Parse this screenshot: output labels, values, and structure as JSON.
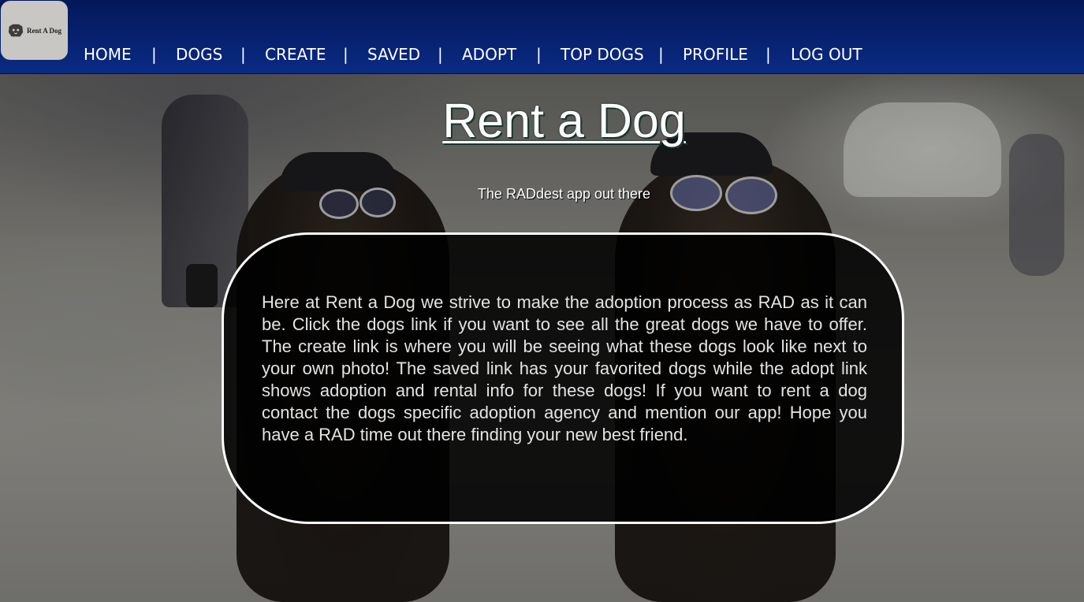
{
  "brand": {
    "logo_text": "Rent A Dog",
    "logo_icon": "dog-head-icon"
  },
  "nav": {
    "items": [
      {
        "label": "HOME"
      },
      {
        "label": "DOGS"
      },
      {
        "label": "CREATE"
      },
      {
        "label": "SAVED"
      },
      {
        "label": "ADOPT"
      },
      {
        "label": "TOP DOGS"
      },
      {
        "label": "PROFILE"
      },
      {
        "label": "LOG OUT"
      }
    ],
    "separator": "|"
  },
  "hero": {
    "title": "Rent a Dog",
    "subtitle": "The RADdest app out there"
  },
  "info": {
    "text": "Here at Rent a Dog we strive to make the adoption process as RAD as it can be. Click the dogs link if you want to see all the great dogs we have to offer. The create link is where you will be seeing what these dogs look like next to your own photo! The saved link has your favorited dogs while the adopt link shows adoption and rental info for these dogs! If you want to rent a dog contact the dogs specific adoption agency and mention our app! Hope you have a RAD time out there finding your new best friend."
  },
  "colors": {
    "navbar": "#0a2a83",
    "info_box_bg": "#000000",
    "info_box_border": "#ffffff",
    "text": "#ffffff"
  }
}
